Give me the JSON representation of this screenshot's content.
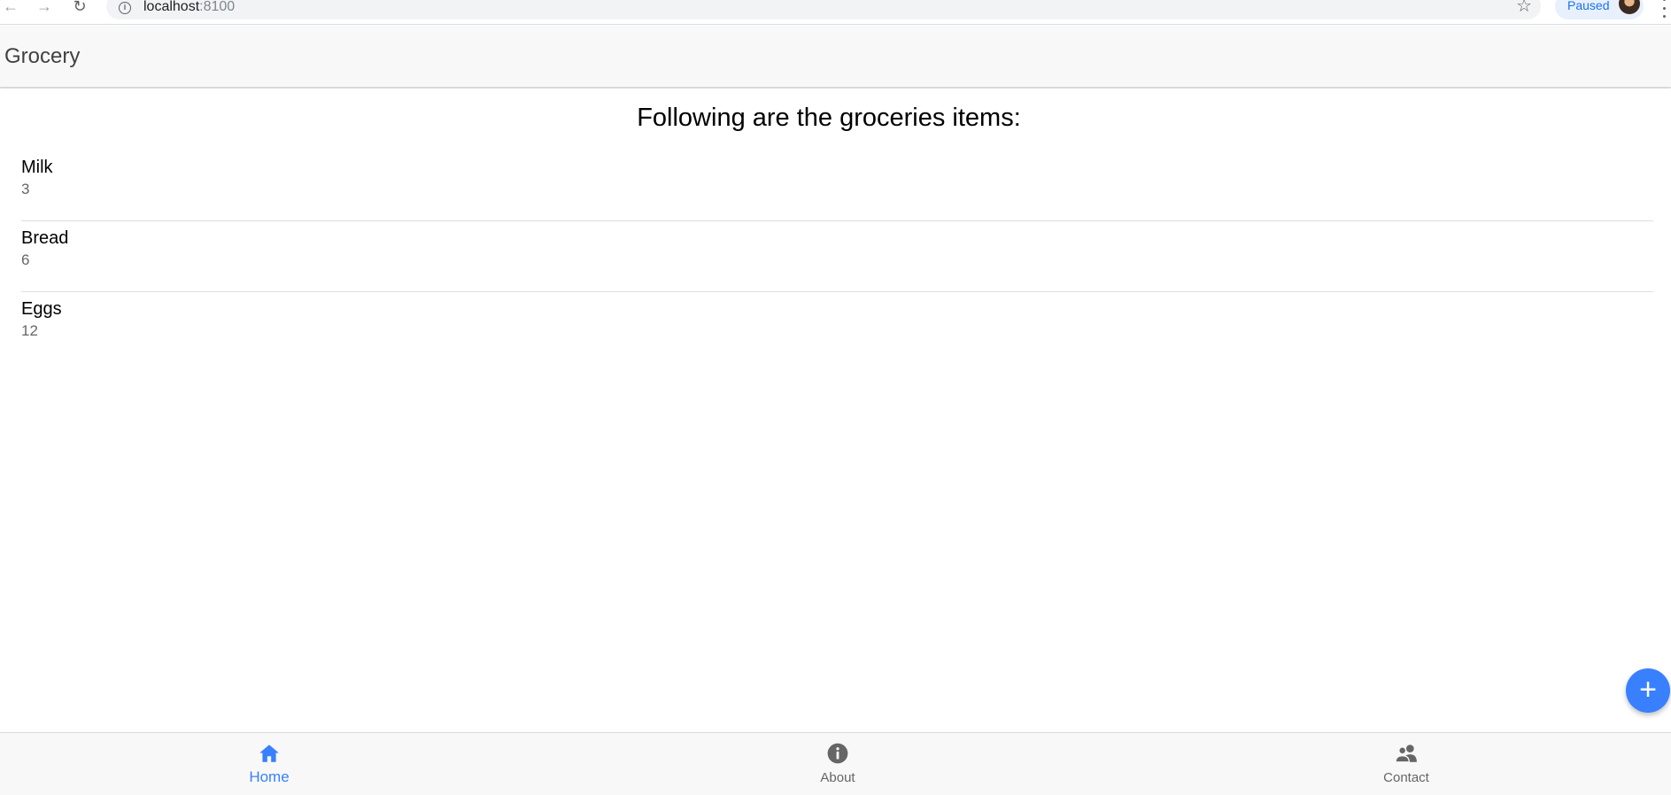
{
  "browser": {
    "url_host": "localhost",
    "url_port": ":8100",
    "paused_label": "Paused"
  },
  "header": {
    "title": "Grocery"
  },
  "main": {
    "heading": "Following are the groceries items:",
    "items": [
      {
        "name": "Milk",
        "quantity": "3"
      },
      {
        "name": "Bread",
        "quantity": "6"
      },
      {
        "name": "Eggs",
        "quantity": "12"
      }
    ]
  },
  "fab": {
    "icon": "add-icon",
    "glyph": "+"
  },
  "tabs": [
    {
      "label": "Home",
      "icon": "home-icon",
      "selected": true
    },
    {
      "label": "About",
      "icon": "info-circle-icon",
      "selected": false
    },
    {
      "label": "Contact",
      "icon": "people-icon",
      "selected": false
    }
  ],
  "colors": {
    "primary": "#3880ff",
    "toolbar_bg": "#f8f8f8",
    "inactive_tab": "#666666"
  }
}
